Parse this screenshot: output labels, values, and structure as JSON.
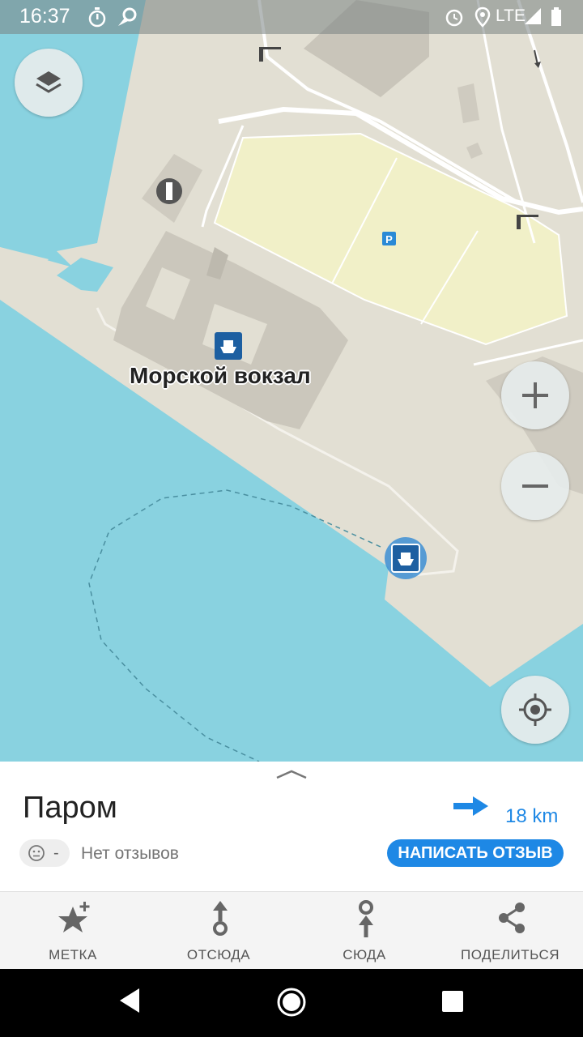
{
  "status_bar": {
    "time": "16:37",
    "network": "LTE",
    "icons": [
      "stopwatch-icon",
      "app-notification-icon",
      "alarm-icon",
      "location-icon",
      "signal-icon",
      "battery-icon"
    ]
  },
  "map": {
    "place_label": "Морской вокзал",
    "colors": {
      "water": "#89d2e0",
      "land": "#e2dfd3",
      "parking": "#f1f0c8",
      "building": "#cfcbc0",
      "accent": "#1e88e5"
    },
    "controls": [
      "layers-button",
      "zoom-in-button",
      "zoom-out-button",
      "my-location-button"
    ]
  },
  "sheet": {
    "title": "Паром",
    "distance": "18 km",
    "rating": "-",
    "reviews_text": "Нет отзывов",
    "write_review": "НАПИСАТЬ ОТЗЫВ"
  },
  "actions": [
    {
      "label": "МЕТКА",
      "icon": "star-plus-icon"
    },
    {
      "label": "ОТСЮДА",
      "icon": "route-from-icon"
    },
    {
      "label": "СЮДА",
      "icon": "route-to-icon"
    },
    {
      "label": "ПОДЕЛИТЬСЯ",
      "icon": "share-icon"
    }
  ]
}
